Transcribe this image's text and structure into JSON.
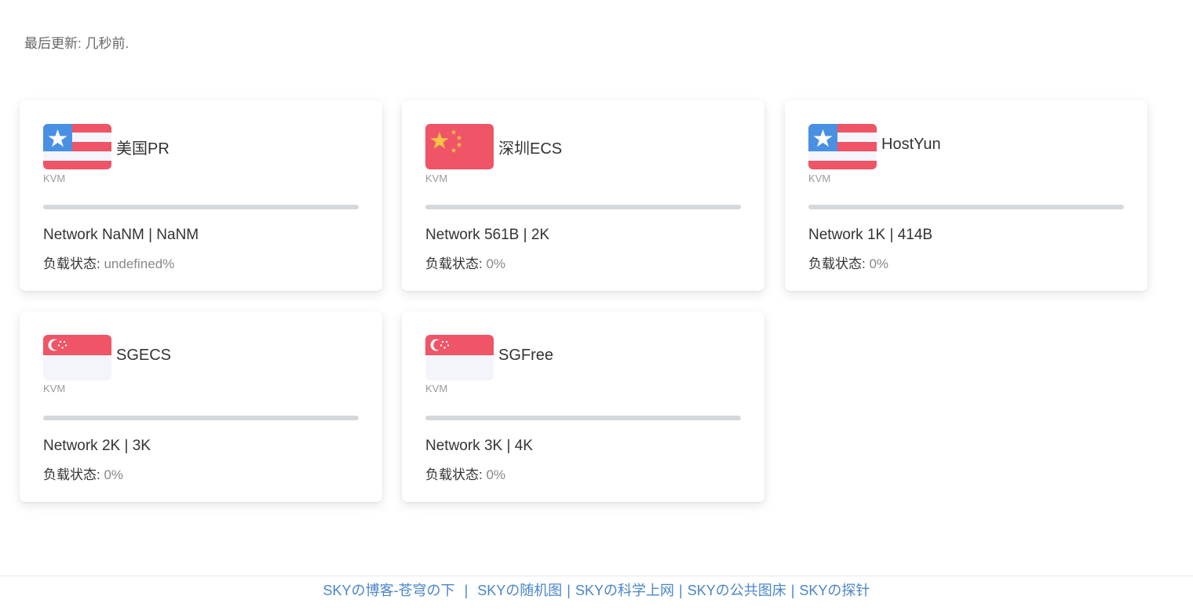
{
  "header": {
    "updated_text": "最后更新: 几秒前."
  },
  "servers": [
    {
      "name": "美国PR",
      "type": "KVM",
      "flag": "us-flag-icon",
      "network": "Network NaNM | NaNM",
      "load_label": "负载状态:",
      "load_value": "undefined%"
    },
    {
      "name": "深圳ECS",
      "type": "KVM",
      "flag": "cn-flag-icon",
      "network": "Network 561B | 2K",
      "load_label": "负载状态:",
      "load_value": "0%"
    },
    {
      "name": "HostYun",
      "type": "KVM",
      "flag": "us-flag-icon",
      "network": "Network 1K | 414B",
      "load_label": "负载状态:",
      "load_value": "0%"
    },
    {
      "name": "SGECS",
      "type": "KVM",
      "flag": "sg-flag-icon",
      "network": "Network 2K | 3K",
      "load_label": "负载状态:",
      "load_value": "0%"
    },
    {
      "name": "SGFree",
      "type": "KVM",
      "flag": "sg-flag-icon",
      "network": "Network 3K | 4K",
      "load_label": "负载状态:",
      "load_value": "0%"
    }
  ],
  "footer": {
    "links": [
      "SKYの博客-苍穹の下",
      "SKYの随机图",
      "SKYの科学上网",
      "SKYの公共图床",
      "SKYの探针"
    ],
    "separators": [
      "|",
      "|",
      "|",
      "|"
    ]
  },
  "colors": {
    "flag_red": "#ef5467",
    "flag_blue": "#4a90e2",
    "flag_white": "#f4f5fa",
    "flag_yellow": "#f6c344",
    "bar_track": "#d5d8dc",
    "link": "#4a86c8"
  }
}
